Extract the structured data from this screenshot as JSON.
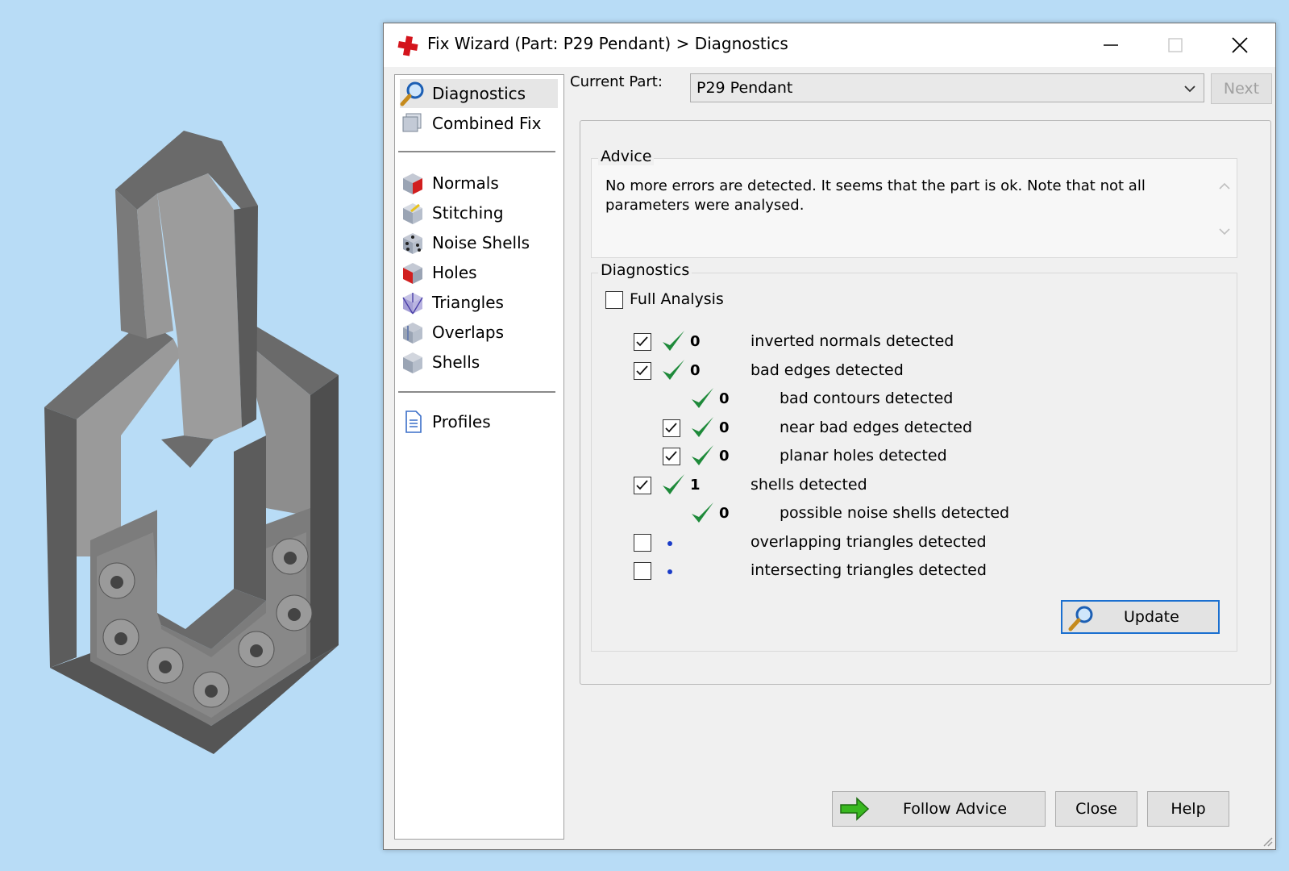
{
  "colors": {
    "desktop_bg": "#b8dcf6",
    "accent_border": "#1a6fd0",
    "check_green": "#1e8a3a",
    "dot_blue": "#1a3cc8"
  },
  "window": {
    "title": "Fix Wizard (Part: P29 Pendant) > Diagnostics",
    "controls": [
      "minimize-icon",
      "maximize-icon",
      "close-icon"
    ]
  },
  "nav": {
    "top": [
      {
        "label": "Diagnostics",
        "icon": "magnifier-icon",
        "selected": true
      },
      {
        "label": "Combined Fix",
        "icon": "combined-fix-icon"
      }
    ],
    "tools": [
      {
        "label": "Normals",
        "icon": "normals-icon"
      },
      {
        "label": "Stitching",
        "icon": "stitching-icon"
      },
      {
        "label": "Noise Shells",
        "icon": "noise-shells-icon"
      },
      {
        "label": "Holes",
        "icon": "holes-icon"
      },
      {
        "label": "Triangles",
        "icon": "triangles-icon"
      },
      {
        "label": "Overlaps",
        "icon": "overlaps-icon"
      },
      {
        "label": "Shells",
        "icon": "shells-icon"
      }
    ],
    "bottom": [
      {
        "label": "Profiles",
        "icon": "document-icon"
      }
    ]
  },
  "current_part": {
    "label": "Current Part:",
    "value": "P29 Pendant",
    "next_label": "Next"
  },
  "advice": {
    "title": "Advice",
    "text": "No more errors are detected. It seems that the part is ok. Note that not all parameters were analysed."
  },
  "diagnostics": {
    "title": "Diagnostics",
    "full_analysis": {
      "label": "Full Analysis",
      "checked": false
    },
    "rows": [
      {
        "checked": true,
        "has_checkbox": true,
        "ok": true,
        "count": "0",
        "label": "inverted normals detected",
        "indent": 0
      },
      {
        "checked": true,
        "has_checkbox": true,
        "ok": true,
        "count": "0",
        "label": "bad edges detected",
        "indent": 0
      },
      {
        "checked": false,
        "has_checkbox": false,
        "ok": true,
        "count": "0",
        "label": "bad contours detected",
        "indent": 1
      },
      {
        "checked": true,
        "has_checkbox": true,
        "ok": true,
        "count": "0",
        "label": "near bad edges detected",
        "indent": 1
      },
      {
        "checked": true,
        "has_checkbox": true,
        "ok": true,
        "count": "0",
        "label": "planar holes detected",
        "indent": 1
      },
      {
        "checked": true,
        "has_checkbox": true,
        "ok": true,
        "count": "1",
        "label": "shells detected",
        "indent": 0
      },
      {
        "checked": false,
        "has_checkbox": false,
        "ok": true,
        "count": "0",
        "label": "possible noise shells detected",
        "indent": 1
      },
      {
        "checked": false,
        "has_checkbox": true,
        "ok": false,
        "count": "",
        "label": "overlapping triangles detected",
        "indent": 0
      },
      {
        "checked": false,
        "has_checkbox": true,
        "ok": false,
        "count": "",
        "label": "intersecting triangles detected",
        "indent": 0
      }
    ],
    "update_label": "Update"
  },
  "buttons": {
    "follow_advice": "Follow Advice",
    "close": "Close",
    "help": "Help"
  }
}
